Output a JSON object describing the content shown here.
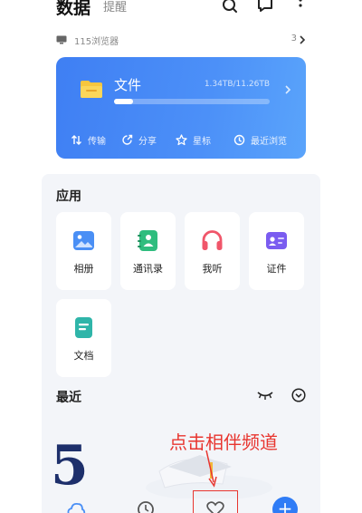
{
  "header": {
    "tab_active": "数据",
    "tab_inactive": "提醒"
  },
  "device_row": {
    "label": "115浏览器",
    "count": "3"
  },
  "file_card": {
    "title": "文件",
    "storage": "1.34TB/11.26TB",
    "storage_used_fraction": 0.12,
    "actions": [
      "传输",
      "分享",
      "星标",
      "最近浏览"
    ]
  },
  "apps": {
    "title": "应用",
    "items": [
      {
        "label": "相册",
        "icon": "photo-icon",
        "color": "#4a8ff5"
      },
      {
        "label": "通讯录",
        "icon": "contacts-icon",
        "color": "#2fbd7e"
      },
      {
        "label": "我听",
        "icon": "headphones-icon",
        "color": "#f0566a"
      },
      {
        "label": "证件",
        "icon": "id-card-icon",
        "color": "#7a5cf0"
      },
      {
        "label": "文档",
        "icon": "document-icon",
        "color": "#2fb5a9"
      }
    ]
  },
  "recent": {
    "title": "最近"
  },
  "annotation": {
    "text": "点击相伴频道",
    "color": "#e8352f"
  },
  "illustration": {
    "numeral": "5"
  },
  "colors": {
    "accent": "#3f7ff3",
    "panel_bg": "#f3f5f9"
  }
}
